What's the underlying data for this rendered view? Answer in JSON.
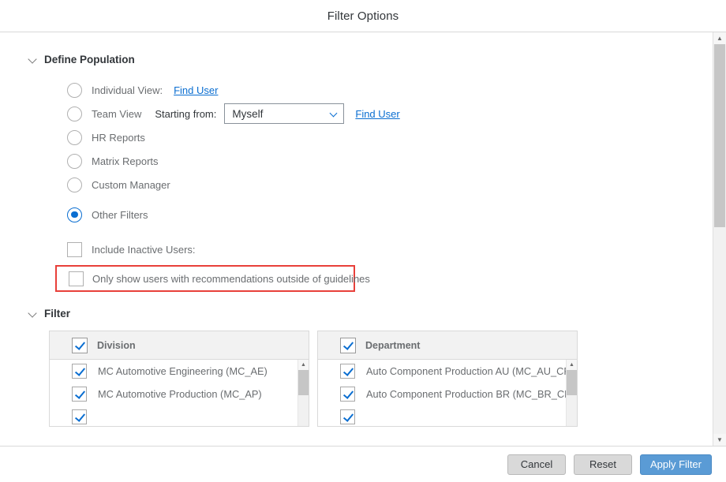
{
  "dialog": {
    "title": "Filter Options"
  },
  "define_population": {
    "section_title": "Define Population",
    "chevron_icon": "chevron-down-icon",
    "options": [
      {
        "id": "individual-view",
        "label": "Individual View:",
        "selected": false,
        "link": "Find User"
      },
      {
        "id": "team-view",
        "label": "Team View",
        "selected": false,
        "starting_from_label": "Starting from:",
        "starting_from_value": "Myself",
        "link": "Find User",
        "caret_icon": "chevron-down-icon"
      },
      {
        "id": "hr-reports",
        "label": "HR Reports",
        "selected": false
      },
      {
        "id": "matrix-reports",
        "label": "Matrix Reports",
        "selected": false
      },
      {
        "id": "custom-manager",
        "label": "Custom Manager",
        "selected": false
      },
      {
        "id": "other-filters",
        "label": "Other Filters",
        "selected": true
      }
    ],
    "checkboxes": [
      {
        "id": "include-inactive-users",
        "label": "Include Inactive Users:",
        "checked": false,
        "highlighted": false
      },
      {
        "id": "only-outside-guidelines",
        "label": "Only show users with recommendations outside of guidelines",
        "checked": false,
        "highlighted": true
      }
    ]
  },
  "filter": {
    "section_title": "Filter",
    "chevron_icon": "chevron-down-icon",
    "tables": [
      {
        "id": "division",
        "header_label": "Division",
        "header_checked": true,
        "rows": [
          {
            "label": "MC Automotive Engineering (MC_AE)",
            "checked": true
          },
          {
            "label": "MC Automotive Production (MC_AP)",
            "checked": true
          }
        ],
        "scroll_up_icon": "chevron-up-icon"
      },
      {
        "id": "department",
        "header_label": "Department",
        "header_checked": true,
        "rows": [
          {
            "label": "Auto Component Production AU (MC_AU_CP)",
            "checked": true
          },
          {
            "label": "Auto Component Production BR (MC_BR_CP)",
            "checked": true
          }
        ],
        "scroll_up_icon": "chevron-up-icon"
      }
    ]
  },
  "footer": {
    "cancel_label": "Cancel",
    "reset_label": "Reset",
    "apply_label": "Apply Filter"
  },
  "scrollbar": {
    "up_icon": "chevron-up-icon",
    "down_icon": "chevron-down-icon"
  },
  "colors": {
    "accent": "#0a6ed1",
    "primary_button": "#5a9bd5",
    "highlight": "#e8403a",
    "text": "#32363a",
    "muted_text": "#6a6d70"
  }
}
